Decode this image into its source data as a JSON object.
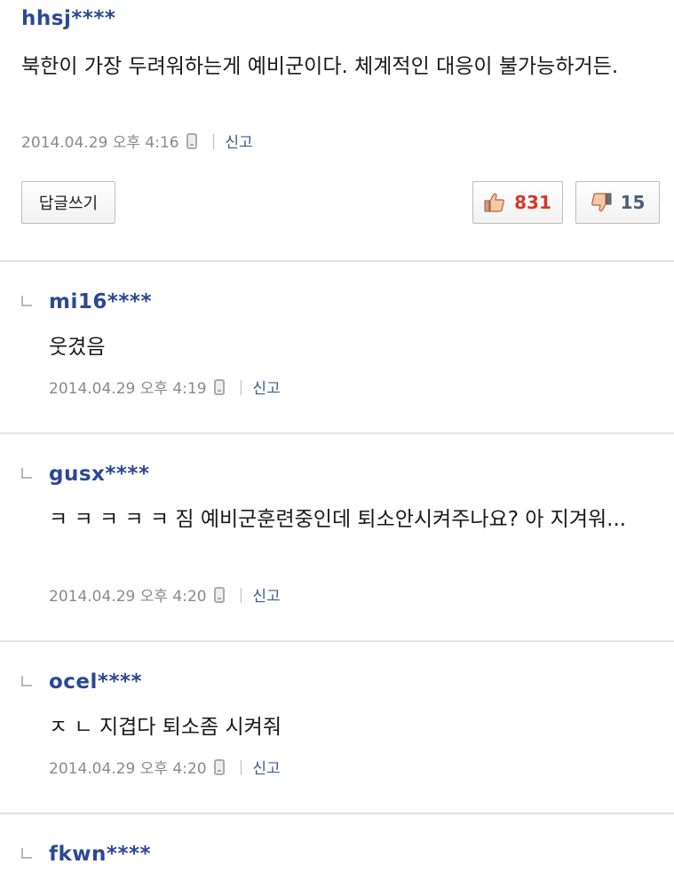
{
  "main_comment": {
    "author": "hhsj****",
    "text": "북한이 가장 두려워하는게 예비군이다. 체계적인 대응이 불가능하거든.",
    "date": "2014.04.29 오후 4:16",
    "report_label": "신고",
    "reply_button_label": "답글쓰기",
    "upvotes": "831",
    "downvotes": "15",
    "icons": {
      "device": "mobile-phone-icon",
      "upvote": "thumbs-up-icon",
      "downvote": "thumbs-down-icon"
    },
    "colors": {
      "author": "#2b4896",
      "upvote": "#d23a2a",
      "downvote": "#4e5d78"
    }
  },
  "replies": [
    {
      "author": "mi16****",
      "text": "웃겼음",
      "date": "2014.04.29 오후 4:19",
      "report_label": "신고"
    },
    {
      "author": "gusx****",
      "text": "ㅋ ㅋ ㅋ ㅋ ㅋ 짐 예비군훈련중인데 퇴소안시켜주나요? 아 지겨워...",
      "date": "2014.04.29 오후 4:20",
      "report_label": "신고"
    },
    {
      "author": "ocel****",
      "text": "ㅈ ㄴ 지겹다 퇴소좀 시켜줘",
      "date": "2014.04.29 오후 4:20",
      "report_label": "신고"
    },
    {
      "author": "fkwn****"
    }
  ]
}
